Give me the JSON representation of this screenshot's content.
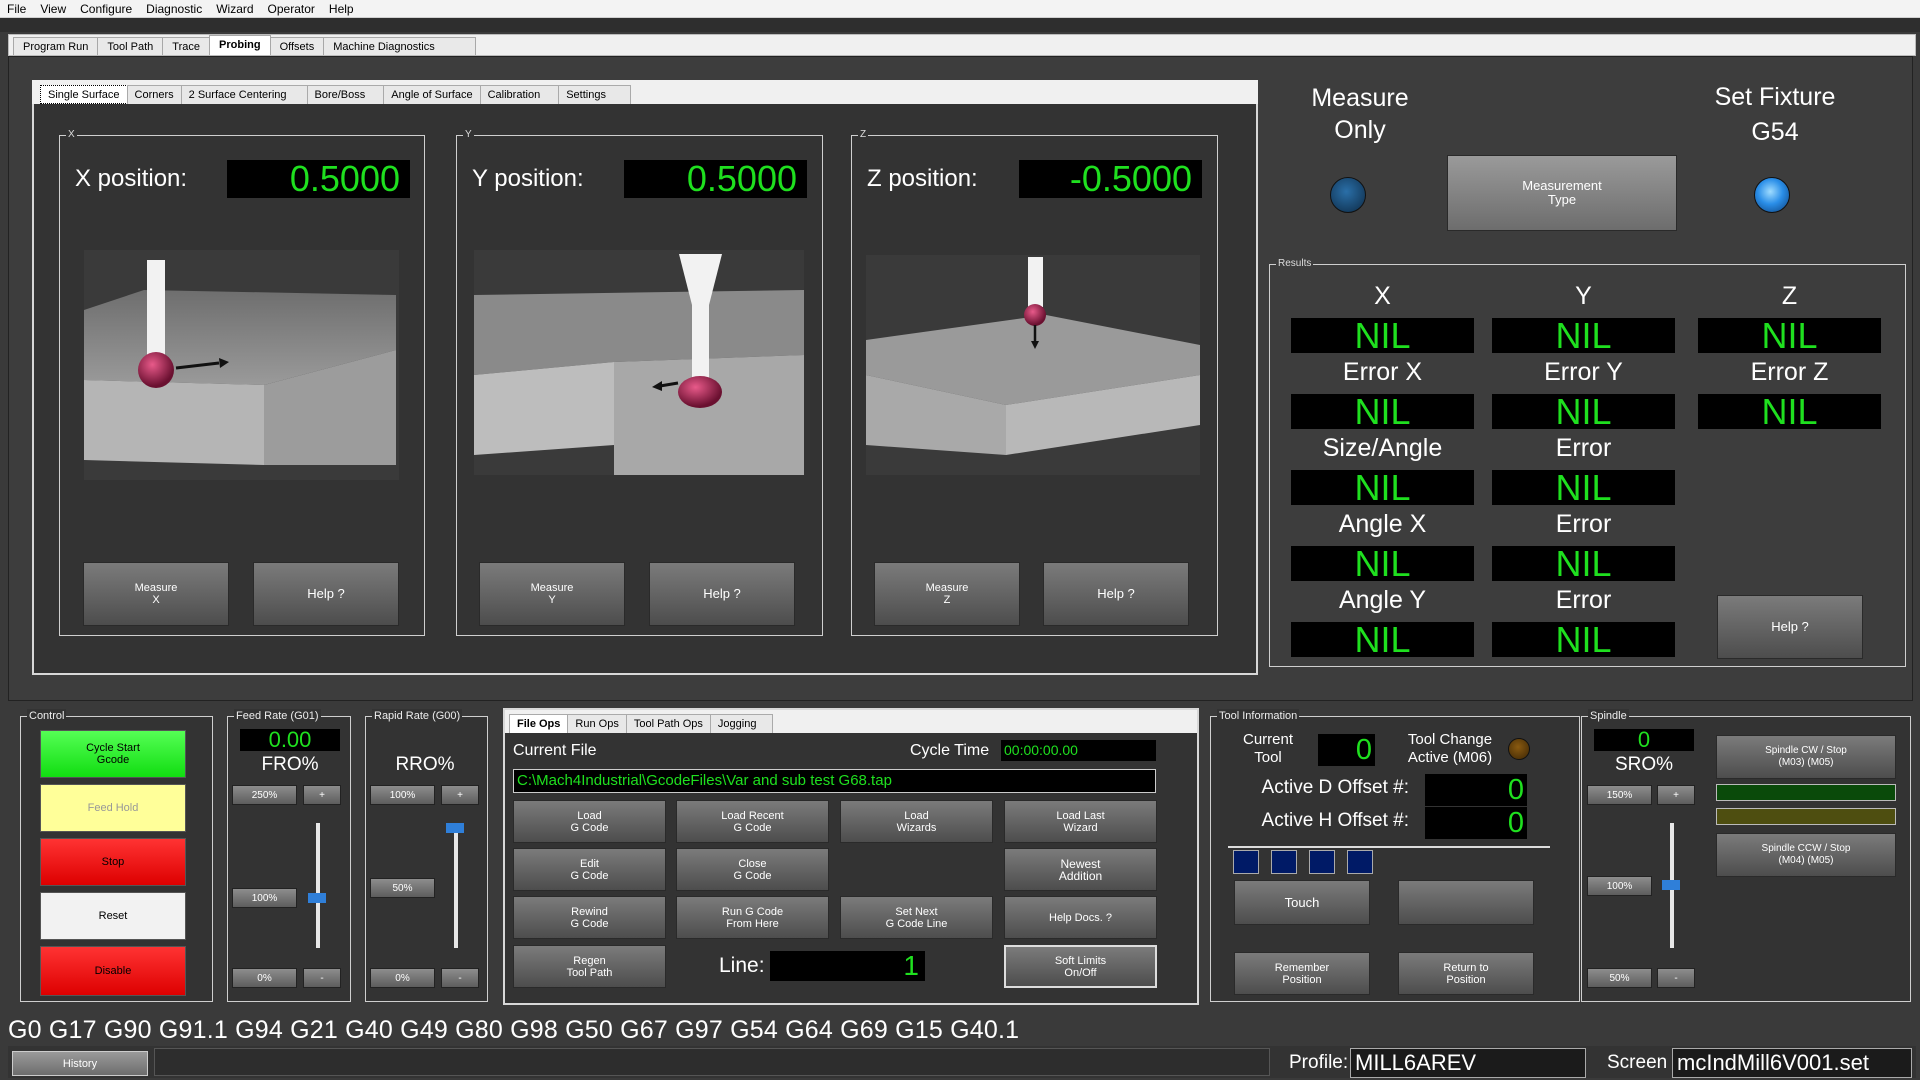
{
  "menu": [
    "File",
    "View",
    "Configure",
    "Diagnostic",
    "Wizard",
    "Operator",
    "Help"
  ],
  "main_tabs": [
    "Program Run",
    "Tool Path",
    "Trace",
    "Probing",
    "Offsets",
    "Machine Diagnostics"
  ],
  "probe_tabs": [
    "Single Surface",
    "Corners",
    "2 Surface Centering",
    "Bore/Boss",
    "Angle of Surface",
    "Calibration",
    "Settings"
  ],
  "probe": {
    "x": {
      "group": "X",
      "label": "X position:",
      "value": "0.5000",
      "measure": "Measure\nX",
      "help": "Help ?"
    },
    "y": {
      "group": "Y",
      "label": "Y position:",
      "value": "0.5000",
      "measure": "Measure\nY",
      "help": "Help ?"
    },
    "z": {
      "group": "Z",
      "label": "Z position:",
      "value": "-0.5000",
      "measure": "Measure\nZ",
      "help": "Help ?"
    }
  },
  "measure_only": "Measure\nOnly",
  "set_fixture": "Set Fixture\nG54",
  "measurement_type": "Measurement\nType",
  "results": {
    "title": "Results",
    "headers": [
      "X",
      "Y",
      "Z"
    ],
    "labels": [
      "Error X",
      "Error Y",
      "Error Z",
      "Size/Angle",
      "Error",
      "Angle X",
      "Error",
      "Angle Y",
      "Error"
    ],
    "nil": "NIL",
    "help": "Help ?"
  },
  "control": {
    "title": "Control",
    "cycle_start": "Cycle Start\nGcode",
    "feed_hold": "Feed Hold",
    "stop": "Stop",
    "reset": "Reset",
    "disable": "Disable"
  },
  "feed": {
    "title": "Feed Rate (G01)",
    "value": "0.00",
    "label": "FRO%",
    "b250": "250%",
    "plus": "+",
    "b100": "100%",
    "b0": "0%",
    "minus": "-",
    "level": 100
  },
  "rapid": {
    "title": "Rapid Rate (G00)",
    "label": "RRO%",
    "b100": "100%",
    "plus": "+",
    "b50": "50%",
    "b0": "0%",
    "minus": "-",
    "level": 100
  },
  "fileops": {
    "tabs": [
      "File Ops",
      "Run Ops",
      "Tool Path Ops",
      "Jogging"
    ],
    "current_file": "Current File",
    "cycle_time_label": "Cycle Time",
    "cycle_time": "00:00:00.00",
    "path": "C:\\Mach4Industrial\\GcodeFiles\\Var and sub test G68.tap",
    "buttons": [
      "Load\nG Code",
      "Load Recent\nG Code",
      "Load\nWizards",
      "Load Last\nWizard",
      "Edit\nG Code",
      "Close\nG Code",
      "Newest\nAddition",
      "Rewind\nG Code",
      "Run G Code\nFrom Here",
      "Set Next\nG Code Line",
      "Help Docs. ?",
      "Regen\nTool Path",
      "Soft Limits\nOn/Off"
    ],
    "line_label": "Line:",
    "line": "1"
  },
  "tool": {
    "title": "Tool Information",
    "current_tool": "Current\nTool",
    "tool_value": "0",
    "tool_change": "Tool Change\nActive (M06)",
    "d_offset": "Active D Offset #:",
    "d_value": "0",
    "h_offset": "Active H Offset #:",
    "h_value": "0",
    "touch": "Touch",
    "remember": "Remember\nPosition",
    "return": "Return to\nPosition"
  },
  "spindle": {
    "title": "Spindle",
    "value": "0",
    "label": "SRO%",
    "b150": "150%",
    "plus": "+",
    "b100": "100%",
    "b50": "50%",
    "minus": "-",
    "cw": "Spindle CW / Stop\n(M03)          (M05)",
    "ccw": "Spindle CCW / Stop\n(M04)          (M05)",
    "level": 100
  },
  "gcodes": "G0 G17 G90 G91.1 G94 G21 G40 G49 G80 G98 G50 G67 G97 G54 G64 G69 G15 G40.1",
  "status": {
    "history": "History",
    "profile_label": "Profile:",
    "profile": "MILL6AREV",
    "screen_label": "Screen",
    "screen": "mcIndMill6V001.set"
  },
  "colors": {
    "dro_green": "#1fe01f",
    "cycle_start": "#22ee22",
    "feed_hold": "#ffff99",
    "stop": "#ee1111",
    "reset": "#f2f2f2",
    "disable": "#ee1111",
    "led_on": "#3aa0ff",
    "led_off": "#1f4f80"
  }
}
